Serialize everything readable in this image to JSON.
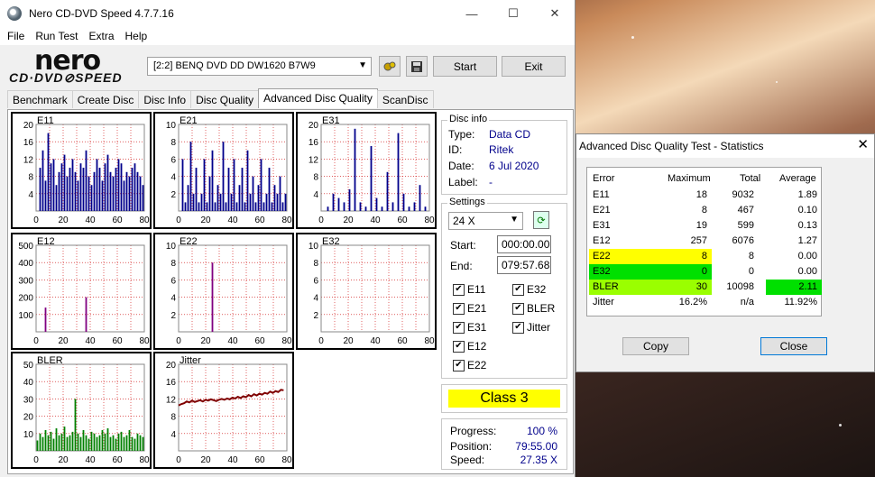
{
  "window": {
    "title": "Nero CD-DVD Speed 4.7.7.16",
    "menu": [
      "File",
      "Run Test",
      "Extra",
      "Help"
    ]
  },
  "logo": {
    "line1": "nero",
    "line2": "CD·DVD⊘SPEED"
  },
  "toolbar": {
    "drive": "[2:2]   BENQ DVD DD DW1620 B7W9",
    "start_label": "Start",
    "exit_label": "Exit"
  },
  "tabs": [
    "Benchmark",
    "Create Disc",
    "Disc Info",
    "Disc Quality",
    "Advanced Disc Quality",
    "ScanDisc"
  ],
  "active_tab": "Advanced Disc Quality",
  "charts": {
    "E11": {
      "label": "E11",
      "yticks": [
        "20",
        "16",
        "12",
        "8",
        "4"
      ],
      "ymax": 20,
      "color": "#00008b",
      "values": [
        0,
        10,
        14,
        7,
        18,
        11,
        12,
        6,
        9,
        11,
        13,
        8,
        10,
        12,
        9,
        7,
        11,
        10,
        14,
        8,
        6,
        9,
        12,
        10,
        7,
        11,
        13,
        9,
        8,
        10,
        12,
        11,
        7,
        9,
        8,
        10,
        11,
        9,
        8,
        6
      ]
    },
    "E21": {
      "label": "E21",
      "yticks": [
        "10",
        "8",
        "6",
        "4",
        "2"
      ],
      "ymax": 10,
      "color": "#00008b",
      "values": [
        0,
        6,
        1,
        3,
        8,
        2,
        5,
        1,
        2,
        6,
        1,
        4,
        7,
        1,
        3,
        2,
        8,
        1,
        5,
        2,
        6,
        1,
        3,
        5,
        1,
        7,
        2,
        4,
        1,
        3,
        6,
        1,
        2,
        5,
        1,
        3,
        2,
        4,
        1,
        2
      ]
    },
    "E31": {
      "label": "E31",
      "yticks": [
        "20",
        "16",
        "12",
        "8",
        "4"
      ],
      "ymax": 20,
      "color": "#00008b",
      "values": [
        0,
        0,
        1,
        0,
        4,
        0,
        3,
        0,
        2,
        0,
        5,
        0,
        19,
        0,
        2,
        0,
        1,
        0,
        15,
        0,
        3,
        0,
        1,
        0,
        9,
        0,
        2,
        0,
        18,
        0,
        4,
        0,
        1,
        0,
        2,
        0,
        6,
        0,
        1,
        0
      ]
    },
    "E12": {
      "label": "E12",
      "yticks": [
        "500",
        "400",
        "300",
        "200",
        "100"
      ],
      "ymax": 500,
      "color": "#800080",
      "values": [
        0,
        0,
        0,
        140,
        0,
        0,
        0,
        0,
        0,
        0,
        0,
        0,
        0,
        0,
        0,
        0,
        0,
        0,
        200,
        0,
        0,
        0,
        0,
        0,
        0,
        0,
        0,
        0,
        0,
        0,
        0,
        0,
        0,
        0,
        0,
        0,
        0,
        0,
        0,
        0
      ]
    },
    "E22": {
      "label": "E22",
      "yticks": [
        "10",
        "8",
        "6",
        "4",
        "2"
      ],
      "ymax": 10,
      "color": "#800080",
      "values": [
        0,
        0,
        0,
        0,
        0,
        0,
        0,
        0,
        0,
        0,
        0,
        0,
        8,
        0,
        0,
        0,
        0,
        0,
        0,
        0,
        0,
        0,
        0,
        0,
        0,
        0,
        0,
        0,
        0,
        0,
        0,
        0,
        0,
        0,
        0,
        0,
        0,
        0,
        0,
        0
      ]
    },
    "E32": {
      "label": "E32",
      "yticks": [
        "10",
        "8",
        "6",
        "4",
        "2"
      ],
      "ymax": 10,
      "color": "#800080",
      "values": [
        0,
        0,
        0,
        0,
        0,
        0,
        0,
        0,
        0,
        0,
        0,
        0,
        0,
        0,
        0,
        0,
        0,
        0,
        0,
        0,
        0,
        0,
        0,
        0,
        0,
        0,
        0,
        0,
        0,
        0,
        0,
        0,
        0,
        0,
        0,
        0,
        0,
        0,
        0,
        0
      ]
    },
    "BLER": {
      "label": "BLER",
      "yticks": [
        "50",
        "40",
        "30",
        "20",
        "10"
      ],
      "ymax": 50,
      "color": "#008000",
      "values": [
        6,
        10,
        8,
        12,
        9,
        11,
        7,
        13,
        9,
        10,
        14,
        8,
        9,
        11,
        30,
        10,
        8,
        12,
        9,
        7,
        11,
        10,
        8,
        9,
        12,
        10,
        13,
        8,
        9,
        7,
        10,
        11,
        8,
        9,
        12,
        8,
        7,
        10,
        9,
        8
      ]
    },
    "Jitter": {
      "label": "Jitter",
      "yticks": [
        "20",
        "16",
        "12",
        "8",
        "4"
      ],
      "ymax": 20,
      "color": "#800000",
      "values": [
        10.5,
        10.8,
        11.0,
        11.4,
        11.2,
        11.6,
        11.3,
        11.5,
        11.7,
        11.4,
        11.8,
        11.6,
        11.9,
        11.7,
        11.5,
        11.8,
        12.0,
        11.8,
        12.1,
        11.9,
        12.3,
        12.1,
        12.5,
        12.2,
        12.6,
        12.4,
        12.9,
        12.6,
        13.1,
        12.8,
        13.2,
        13.0,
        13.4,
        13.2,
        13.7,
        13.4,
        13.8,
        13.6,
        14.1,
        14.0
      ]
    }
  },
  "xticks": [
    "0",
    "20",
    "40",
    "60",
    "80"
  ],
  "disc_info": {
    "title": "Disc info",
    "type_label": "Type:",
    "type": "Data CD",
    "id_label": "ID:",
    "id": "Ritek",
    "date_label": "Date:",
    "date": "6 Jul 2020",
    "label_label": "Label:",
    "label": "-"
  },
  "settings": {
    "title": "Settings",
    "speed": "24 X",
    "start_label": "Start:",
    "start": "000:00.00",
    "end_label": "End:",
    "end": "079:57.68",
    "checkboxes": [
      "E11",
      "E32",
      "E21",
      "BLER",
      "E31",
      "Jitter",
      "E12",
      "E22"
    ]
  },
  "class_label": "Class 3",
  "progress": {
    "progress_label": "Progress:",
    "progress": "100 %",
    "position_label": "Position:",
    "position": "79:55.00",
    "speed_label": "Speed:",
    "speed": "27.35 X"
  },
  "stats": {
    "title": "Advanced Disc Quality Test - Statistics",
    "headers": [
      "Error",
      "Maximum",
      "Total",
      "Average"
    ],
    "rows": [
      {
        "name": "E11",
        "max": "18",
        "total": "9032",
        "avg": "1.89"
      },
      {
        "name": "E21",
        "max": "8",
        "total": "467",
        "avg": "0.10"
      },
      {
        "name": "E31",
        "max": "19",
        "total": "599",
        "avg": "0.13"
      },
      {
        "name": "E12",
        "max": "257",
        "total": "6076",
        "avg": "1.27"
      },
      {
        "name": "E22",
        "max": "8",
        "total": "8",
        "avg": "0.00"
      },
      {
        "name": "E32",
        "max": "0",
        "total": "0",
        "avg": "0.00"
      },
      {
        "name": "BLER",
        "max": "30",
        "total": "10098",
        "avg": "2.11"
      },
      {
        "name": "Jitter",
        "max": "16.2%",
        "total": "n/a",
        "avg": "11.92%"
      }
    ],
    "copy_label": "Copy",
    "close_label": "Close",
    "colors": {
      "yellow": "#ffff00",
      "green": "#00e000",
      "lime": "#9aff00"
    }
  }
}
